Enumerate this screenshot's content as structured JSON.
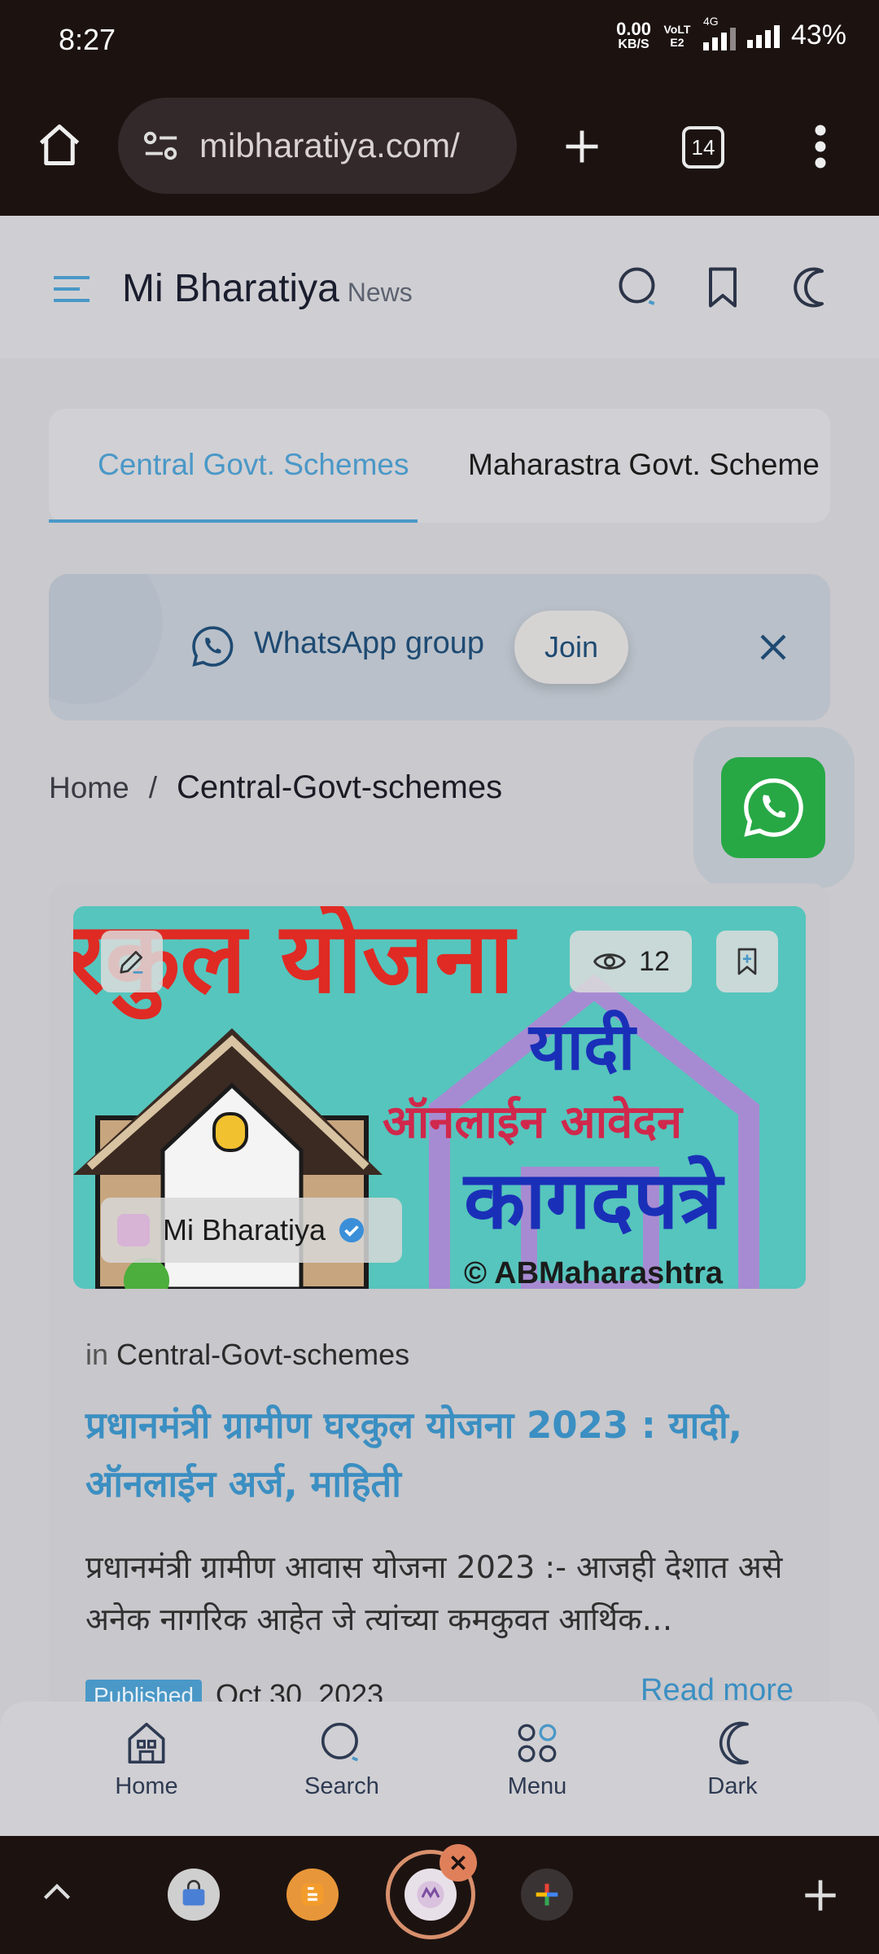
{
  "status_bar": {
    "time": "8:27",
    "net_speed_value": "0.00",
    "net_speed_unit": "KB/S",
    "volte": "VoLTE2",
    "net_type": "4G",
    "battery": "43%"
  },
  "browser": {
    "url": "mibharatiya.com/",
    "tab_count": "14"
  },
  "site": {
    "name": "Mi Bharatiya",
    "sub": "News"
  },
  "categories": {
    "active": "Central Govt. Schemes",
    "other": "Maharastra Govt. Scheme"
  },
  "whatsapp_bar": {
    "label": "WhatsApp group",
    "join": "Join"
  },
  "breadcrumb": {
    "home": "Home",
    "separator": "/",
    "current": "Central-Govt-schemes"
  },
  "post": {
    "views": "12",
    "author": "Mi Bharatiya",
    "in_label": "in",
    "category": "Central-Govt-schemes",
    "title": "प्रधानमंत्री ग्रामीण घरकुल योजना 2023 : यादी, ऑनलाईन अर्ज, माहिती",
    "excerpt": "प्रधानमंत्री ग्रामीण आवास योजना 2023 :- आजही देशात असे अनेक नागरिक आहेत जे त्यांच्या कमकुवत आर्थिक…",
    "published_label": "Published",
    "date": "Oct 30, 2023",
    "read_more": "Read more",
    "thumb_text": {
      "line1": "रकुल योजना",
      "line2": "यादी",
      "line3": "ऑनलाईन आवेदन",
      "line4": "कागदपत्रे",
      "line5": "© ABMaharashtra"
    }
  },
  "bottom_nav": [
    {
      "label": "Home",
      "icon": "home-icon"
    },
    {
      "label": "Search",
      "icon": "search-icon"
    },
    {
      "label": "Menu",
      "icon": "menu-grid-icon"
    },
    {
      "label": "Dark",
      "icon": "moon-icon"
    }
  ],
  "colors": {
    "accent": "#4a98c7",
    "whatsapp": "#27a845",
    "chrome": "#1c1311"
  }
}
